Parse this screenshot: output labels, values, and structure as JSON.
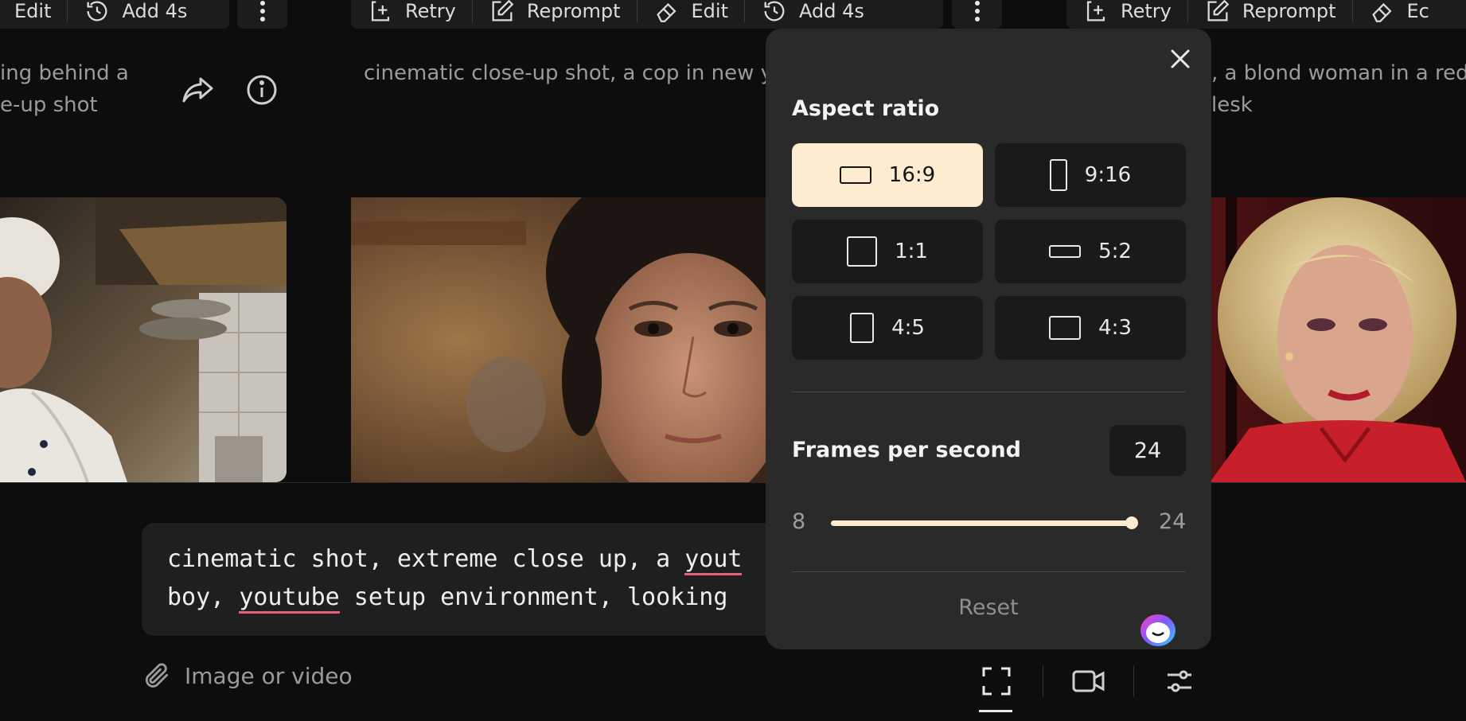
{
  "cards": [
    {
      "actions": {
        "edit": "Edit",
        "add": "Add 4s"
      },
      "caption": [
        "ing behind a",
        "e-up shot"
      ]
    },
    {
      "actions": {
        "retry": "Retry",
        "reprompt": "Reprompt",
        "edit": "Edit",
        "add": "Add 4s"
      },
      "caption": [
        "cinematic close-up shot, a cop in new yo"
      ]
    },
    {
      "actions": {
        "retry": "Retry",
        "reprompt": "Reprompt",
        "edit": "Ec"
      },
      "caption": [
        ", a blond woman in a red c",
        "lesk"
      ]
    }
  ],
  "prompt": {
    "line1_a": "cinematic shot, extreme close up, a ",
    "line1_b": "yout",
    "line2_a": "boy, ",
    "line2_b": "youtube",
    "line2_c": " setup environment, looking "
  },
  "attach": {
    "label": "Image or video"
  },
  "popover": {
    "title": "Aspect ratio",
    "ratios": [
      {
        "label": "16:9",
        "selected": true
      },
      {
        "label": "9:16",
        "selected": false
      },
      {
        "label": "1:1",
        "selected": false
      },
      {
        "label": "5:2",
        "selected": false
      },
      {
        "label": "4:5",
        "selected": false
      },
      {
        "label": "4:3",
        "selected": false
      }
    ],
    "fps_label": "Frames per second",
    "fps_value": "24",
    "slider_min": "8",
    "slider_max": "24",
    "slider_fraction": 1.0,
    "reset_label": "Reset"
  },
  "colors": {
    "accent": "#fdeccf",
    "underline": "#e4607c",
    "panel": "#2a2a2a",
    "bg": "#0d0d0d"
  }
}
